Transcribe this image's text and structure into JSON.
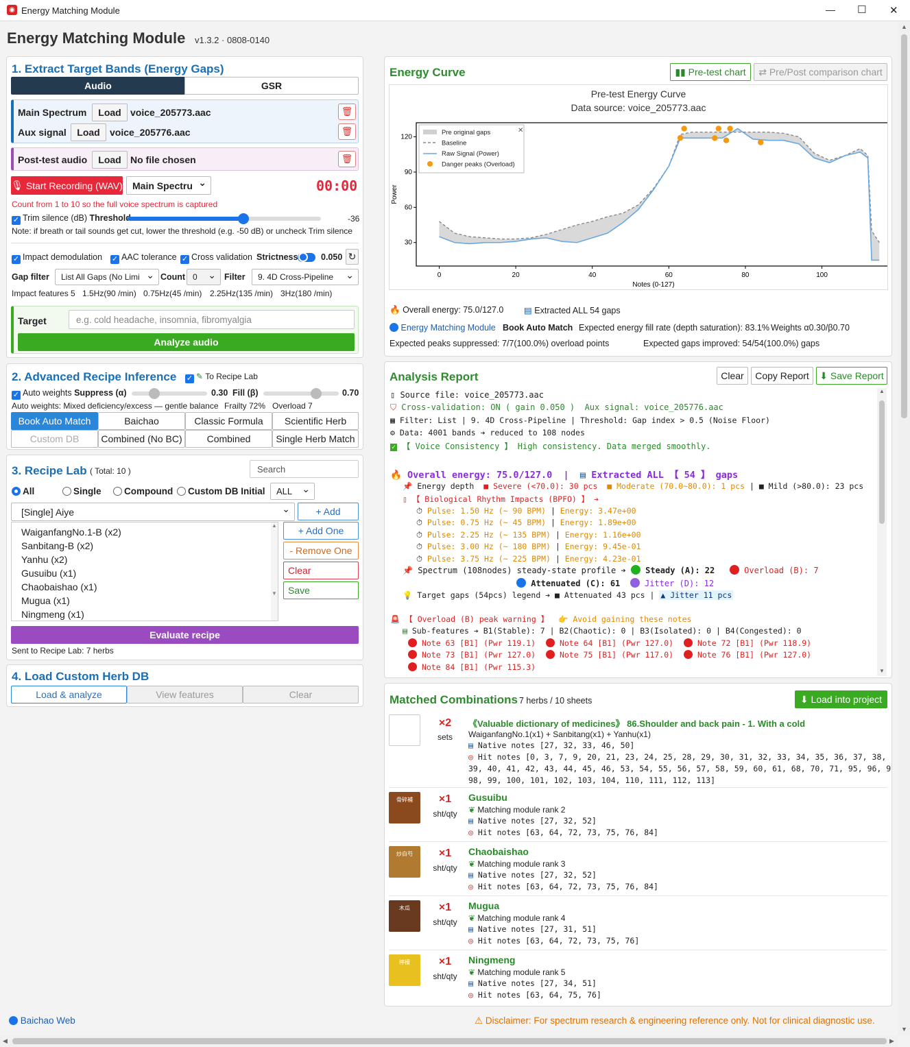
{
  "window": {
    "title": "Energy Matching Module",
    "minimize": "—",
    "maximize": "☐",
    "close": "✕"
  },
  "header": {
    "title": "Energy Matching Module",
    "version": "v1.3.2 · 0808-0140"
  },
  "s1": {
    "title": "1. Extract Target Bands (Energy Gaps)",
    "tabs": [
      "Audio",
      "GSR"
    ],
    "main_label": "Main Spectrum",
    "aux_label": "Aux signal",
    "load": "Load",
    "main_file": "voice_205773.aac",
    "aux_file": "voice_205776.aac",
    "post_label": "Post-test audio",
    "post_file": "No file chosen",
    "record": "Start Recording (WAV)",
    "record_sel": "Main Spectru",
    "timer": "00:00",
    "hint": "Count from 1 to 10 so the full voice spectrum is captured",
    "trim": "Trim silence (dB)",
    "threshold": "Threshold",
    "threshold_val": "-36",
    "threshold_level": 0.6,
    "note": "Note: if breath or tail sounds get cut, lower the threshold (e.g. -50 dB) or uncheck Trim silence",
    "impact": "Impact demodulation",
    "aac": "AAC tolerance",
    "cross": "Cross validation",
    "strictness": "Strictness",
    "strictness_val": "0.050",
    "gap_filter": "Gap filter",
    "gap_sel": "List All Gaps (No Limi",
    "count": "Count",
    "count_val": "0",
    "filter": "Filter",
    "filter_sel": "9. 4D Cross-Pipeline",
    "features": [
      "Impact features 5",
      "1.5Hz(90 /min)",
      "0.75Hz(45 /min)",
      "2.25Hz(135 /min)",
      "3Hz(180 /min)"
    ],
    "target": "Target",
    "target_ph": "e.g. cold headache, insomnia, fibromyalgia",
    "analyze": "Analyze audio"
  },
  "s2": {
    "title": "2. Advanced Recipe Inference",
    "to_lab": "To Recipe Lab",
    "auto": "Auto weights",
    "suppress": "Suppress (α)",
    "suppress_val": "0.30",
    "suppress_level": 0.3,
    "fill": "Fill (β)",
    "fill_val": "0.70",
    "fill_level": 0.7,
    "autoinfo": "Auto weights: Mixed deficiency/excess — gentle balance",
    "frailty": "Frailty 72%",
    "overload": "Overload 7",
    "modes": [
      "Book Auto Match",
      "Baichao",
      "Classic Formula",
      "Scientific Herb",
      "Custom DB",
      "Combined (No BC)",
      "Combined",
      "Single Herb Match"
    ]
  },
  "s3": {
    "title": "3. Recipe Lab",
    "total": "( Total: 10 )",
    "search_ph": "Search",
    "radios": [
      "All",
      "Single",
      "Compound",
      "Custom DB Initial"
    ],
    "all_sel": "ALL",
    "item_sel": "[Single] Aiye",
    "add": "+ Add",
    "add_one": "+ Add One",
    "remove_one": "-  Remove One",
    "clear": "Clear",
    "save": "Save",
    "items": [
      "WaiganfangNo.1-B (x2)",
      "Sanbitang-B (x2)",
      "Yanhu (x2)",
      "Gusuibu (x1)",
      "Chaobaishao (x1)",
      "Mugua (x1)",
      "Ningmeng (x1)"
    ],
    "evaluate": "Evaluate recipe",
    "sent": "Sent to Recipe Lab: 7 herbs"
  },
  "s4": {
    "title": "4. Load Custom Herb DB",
    "buttons": [
      "Load & analyze",
      "View features",
      "Clear"
    ]
  },
  "footer": {
    "web": "Baichao Web",
    "disclaimer": "Disclaimer: For spectrum research & engineering reference only. Not for clinical diagnostic use."
  },
  "curve": {
    "title": "Energy Curve",
    "btn_pre": "Pre-test chart",
    "btn_cmp": "Pre/Post comparison chart",
    "overall": "Overall energy: 75.0/127.0",
    "extracted": "Extracted ALL 54 gaps",
    "module": "Energy Matching Module",
    "book": "Book Auto Match",
    "fill_rate": "Expected energy fill rate (depth saturation): 83.1%",
    "weights": "Weights α0.30/β0.70",
    "peaks": "Expected peaks suppressed: 7/7(100.0%) overload points",
    "gaps": "Expected gaps improved: 54/54(100.0%) gaps"
  },
  "chart_data": {
    "type": "line",
    "title": "Pre-test Energy Curve",
    "subtitle": "Data source: voice_205773.aac",
    "xlabel": "Notes (0-127)",
    "ylabel": "Power",
    "xlim": [
      -6,
      118
    ],
    "ylim": [
      10,
      132
    ],
    "xticks": [
      0,
      20,
      40,
      60,
      80,
      100
    ],
    "yticks": [
      30,
      60,
      90,
      120
    ],
    "legend": {
      "position": "top-left",
      "entries": [
        "Pre original gaps",
        "Baseline",
        "Raw Signal (Power)",
        "Danger peaks (Overload)"
      ]
    },
    "series": [
      {
        "name": "Raw Signal (Power)",
        "x": [
          0,
          4,
          8,
          12,
          16,
          20,
          24,
          28,
          32,
          36,
          40,
          44,
          48,
          52,
          56,
          60,
          63,
          66,
          70,
          74,
          78,
          82,
          86,
          90,
          94,
          98,
          102,
          106,
          110,
          112,
          113,
          115
        ],
        "y": [
          35,
          30,
          29,
          30,
          30,
          31,
          33,
          34,
          31,
          30,
          34,
          38,
          47,
          58,
          75,
          95,
          119,
          119,
          119,
          119,
          127,
          118,
          117,
          117,
          114,
          102,
          98,
          104,
          107,
          102,
          15,
          15
        ]
      },
      {
        "name": "Baseline",
        "x": [
          0,
          4,
          8,
          12,
          16,
          20,
          24,
          28,
          32,
          36,
          40,
          44,
          48,
          52,
          56,
          60,
          63,
          66,
          70,
          74,
          78,
          82,
          86,
          90,
          94,
          98,
          102,
          106,
          110,
          112,
          113,
          115
        ],
        "y": [
          48,
          38,
          35,
          34,
          33,
          33,
          34,
          37,
          41,
          45,
          48,
          52,
          55,
          62,
          76,
          95,
          122,
          124,
          124,
          124,
          124,
          124,
          124,
          123,
          120,
          106,
          100,
          104,
          110,
          104,
          40,
          30
        ]
      },
      {
        "name": "Danger peaks (Overload)",
        "x": [
          63,
          64,
          72,
          73,
          75,
          76,
          84
        ],
        "y": [
          119.1,
          127,
          118.9,
          127,
          117,
          127,
          115.3
        ]
      }
    ]
  },
  "report": {
    "title": "Analysis Report",
    "clear": "Clear",
    "copy": "Copy Report",
    "save": "Save Report",
    "source": "Source file: voice_205773.aac",
    "cv": "Cross-validation: ON ( gain 0.050 )",
    "aux": "Aux signal: voice_205776.aac",
    "filter_line": "Filter: List | 9. 4D Cross-Pipeline | Threshold: Gap index > 0.5 (Noise Floor)",
    "data_line": "Data: 4001 bands ➔ reduced to 108 nodes",
    "voice": "【 Voice Consistency 】 High consistency. Data merged smoothly.",
    "overall": "Overall energy: 75.0/127.0",
    "extracted": "Extracted ALL 【 54 】 gaps",
    "depth_label": "Energy depth",
    "severe": "■ Severe (<70.0): 30 pcs",
    "moderate": "■ Moderate (70.0~80.0): 1 pcs",
    "mild": "■ Mild (>80.0): 23 pcs",
    "bio": "【 Biological Rhythm Impacts (BPFO) 】 ➔",
    "pulses": [
      "Pulse: 1.50 Hz (~ 90 BPM)",
      "Pulse: 0.75 Hz (~ 45 BPM)",
      "Pulse: 2.25 Hz (~ 135 BPM)",
      "Pulse: 3.00 Hz (~ 180 BPM)",
      "Pulse: 3.75 Hz (~ 225 BPM)"
    ],
    "energies": [
      "Energy: 3.47e+00",
      "Energy: 1.89e+00",
      "Energy: 1.16e+00",
      "Energy: 9.45e-01",
      "Energy: 4.23e-01"
    ],
    "spectrum": "Spectrum (108nodes) steady-state profile ➔",
    "steady": "Steady (A): 22",
    "overload": "Overload (B): 7",
    "attenuated": "Attenuated (C): 61",
    "jitter": "Jitter (D): 12",
    "target_gaps": "Target gaps (54pcs) legend ➔ ■ Attenuated 43 pcs |",
    "jitter_pcs": "▲ Jitter 11 pcs",
    "warning": "【 Overload (B) peak warning 】",
    "avoid": "Avoid gaining these notes",
    "subfeat": "Sub-features ➔ B1(Stable): 7 | B2(Chaotic): 0 | B3(Isolated): 0 | B4(Congested): 0",
    "notes": [
      "Note  63 [B1] (Pwr 119.1)",
      "Note  64 [B1] (Pwr 127.0)",
      "Note  72 [B1] (Pwr 118.9)",
      "Note  73 [B1] (Pwr 127.0)",
      "Note  75 [B1] (Pwr 117.0)",
      "Note  76 [B1] (Pwr 127.0)",
      "Note  84 [B1] (Pwr 115.3)"
    ]
  },
  "matched": {
    "title": "Matched Combinations",
    "sub": "7 herbs / 10 sheets",
    "load_btn": "Load into project",
    "first": {
      "mult": "×2",
      "unit": "sets",
      "name": "《Valuable dictionary of medicines》 86.Shoulder and back pain - 1. With a cold",
      "formula": "WaiganfangNo.1(x1) + Sanbitang(x1) + Yanhu(x1)",
      "native": "Native notes [27, 32, 33, 46, 50]",
      "hit1": "Hit notes [0, 3, 7, 9, 20, 21, 23, 24, 25, 28, 29, 30, 31, 32, 33, 34, 35, 36, 37, 38,",
      "hit2": "39, 40, 41, 42, 43, 44, 45, 46, 53, 54, 55, 56, 57, 58, 59, 60, 61, 68, 70, 71, 95, 96, 97,",
      "hit3": "98, 99, 100, 101, 102, 103, 104, 110, 111, 112, 113]"
    },
    "herbs": [
      {
        "mult": "×1",
        "unit": "sht/qty",
        "name": "Gusuibu",
        "rank": "Matching module rank 2",
        "native": "Native notes [27, 32, 52]",
        "hit": "Hit notes [63, 64, 72, 73, 75, 76, 84]",
        "label": "骨碎補",
        "color": "#8a4a1e"
      },
      {
        "mult": "×1",
        "unit": "sht/qty",
        "name": "Chaobaishao",
        "rank": "Matching module rank 3",
        "native": "Native notes [27, 32, 52]",
        "hit": "Hit notes [63, 64, 72, 73, 75, 76, 84]",
        "label": "炒白芍",
        "color": "#b07a30"
      },
      {
        "mult": "×1",
        "unit": "sht/qty",
        "name": "Mugua",
        "rank": "Matching module rank 4",
        "native": "Native notes [27, 31, 51]",
        "hit": "Hit notes [63, 64, 72, 73, 75, 76]",
        "label": "木瓜",
        "color": "#6a3a20"
      },
      {
        "mult": "×1",
        "unit": "sht/qty",
        "name": "Ningmeng",
        "rank": "Matching module rank 5",
        "native": "Native notes [27, 34, 51]",
        "hit": "Hit notes [63, 64, 75, 76]",
        "label": "檸檬",
        "color": "#e8c020"
      }
    ]
  }
}
